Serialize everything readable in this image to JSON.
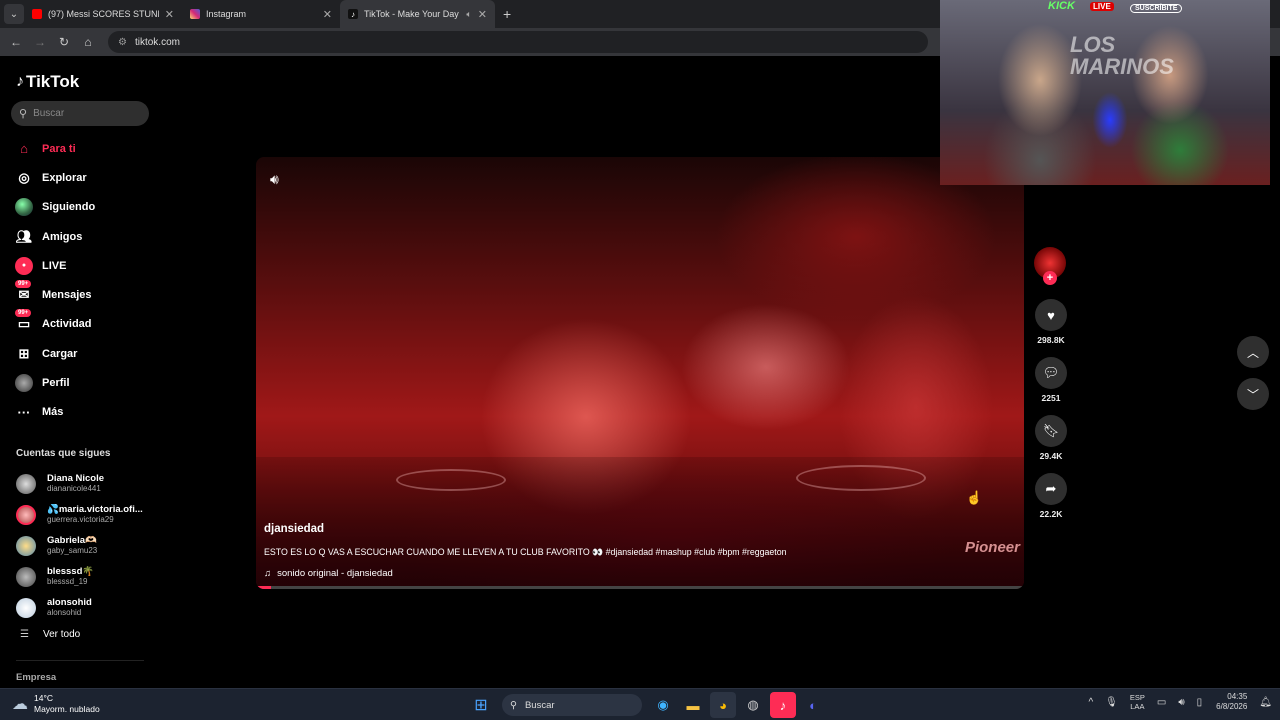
{
  "browser": {
    "tabs": [
      {
        "title": "(97) Messi SCORES STUNNING",
        "icon": "youtube-icon",
        "color": "#ff0000"
      },
      {
        "title": "Instagram",
        "icon": "instagram-icon",
        "color": "#d62976"
      },
      {
        "title": "TikTok - Make Your Day",
        "icon": "tiktok-icon",
        "color": "#000000",
        "active": true
      }
    ],
    "url": "tiktok.com"
  },
  "tiktok": {
    "logo": "TikTok",
    "search_placeholder": "Buscar",
    "menu": [
      {
        "label": "Para ti",
        "icon": "home-icon",
        "active": true
      },
      {
        "label": "Explorar",
        "icon": "compass-icon"
      },
      {
        "label": "Siguiendo",
        "icon": "following-avatar-icon"
      },
      {
        "label": "Amigos",
        "icon": "friends-icon"
      },
      {
        "label": "LIVE",
        "icon": "live-icon"
      },
      {
        "label": "Mensajes",
        "icon": "messages-icon",
        "badge": "99+"
      },
      {
        "label": "Actividad",
        "icon": "activity-icon",
        "badge": "99+"
      },
      {
        "label": "Cargar",
        "icon": "upload-icon"
      },
      {
        "label": "Perfil",
        "icon": "profile-avatar-icon"
      },
      {
        "label": "Más",
        "icon": "more-icon"
      }
    ],
    "following_title": "Cuentas que sigues",
    "following": [
      {
        "name": "Diana Nicole",
        "handle": "diananicole441"
      },
      {
        "name": "💦maria.victoria.ofi...",
        "handle": "guerrera.victoria29"
      },
      {
        "name": "Gabriela🫶🏻",
        "handle": "gaby_samu23"
      },
      {
        "name": "blesssd🌴",
        "handle": "blesssd_19"
      },
      {
        "name": "alonsohid",
        "handle": "alonsohid"
      }
    ],
    "see_all": "Ver todo",
    "footer_section": "Empresa",
    "video": {
      "author": "djansiedad",
      "description": "ESTO ES LO Q VAS A ESCUCHAR CUANDO ME LLEVEN A TU CLUB FAVORITO 👀 #djansiedad #mashup #club #bpm #reggaeton",
      "sound": "sonido original - djansiedad",
      "progress": 0.02,
      "deck_brand": "Pioneer"
    },
    "actions": {
      "likes": "298.8K",
      "comments": "2251",
      "saves": "29.4K",
      "shares": "22.2K"
    }
  },
  "webcam": {
    "overlay_text": "LOS MARINOS",
    "kick_label": "KICK",
    "live_label": "LIVE",
    "subscribe_label": "SUSCRÍBITE"
  },
  "taskbar": {
    "weather_temp": "14°C",
    "weather_desc": "Mayorm. nublado",
    "search_label": "Buscar",
    "lang_top": "ESP",
    "lang_bottom": "LAA",
    "time": "04:35",
    "date": "6/8/2026"
  }
}
